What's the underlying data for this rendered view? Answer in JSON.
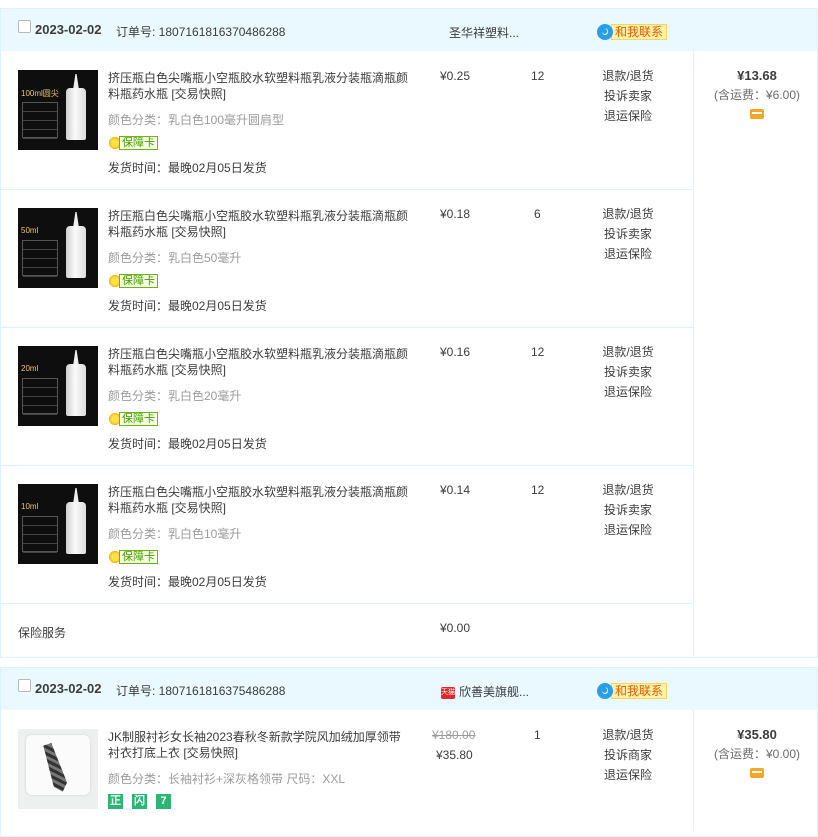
{
  "orders": [
    {
      "date": "2023-02-02",
      "order_no": "订单号: 1807161816370486288",
      "shop": "圣华祥塑料...",
      "contact": "和我联系",
      "items": [
        {
          "thumb_label": "100ml圆尖",
          "title": "挤压瓶白色尖嘴瓶小空瓶胶水软塑料瓶乳液分装瓶滴瓶颜料瓶药水瓶 [交易快照]",
          "spec": "颜色分类：乳白色100毫升圆肩型",
          "badge": "保障卡",
          "ship": "发货时间：最晚02月05日发货",
          "price": "¥0.25",
          "qty": "12",
          "ops": [
            "退款/退货",
            "投诉卖家",
            "退运保险"
          ]
        },
        {
          "thumb_label": "50ml",
          "title": "挤压瓶白色尖嘴瓶小空瓶胶水软塑料瓶乳液分装瓶滴瓶颜料瓶药水瓶 [交易快照]",
          "spec": "颜色分类：乳白色50毫升",
          "badge": "保障卡",
          "ship": "发货时间：最晚02月05日发货",
          "price": "¥0.18",
          "qty": "6",
          "ops": [
            "退款/退货",
            "投诉卖家",
            "退运保险"
          ]
        },
        {
          "thumb_label": "20ml",
          "title": "挤压瓶白色尖嘴瓶小空瓶胶水软塑料瓶乳液分装瓶滴瓶颜料瓶药水瓶 [交易快照]",
          "spec": "颜色分类：乳白色20毫升",
          "badge": "保障卡",
          "ship": "发货时间：最晚02月05日发货",
          "price": "¥0.16",
          "qty": "12",
          "ops": [
            "退款/退货",
            "投诉卖家",
            "退运保险"
          ]
        },
        {
          "thumb_label": "10ml",
          "title": "挤压瓶白色尖嘴瓶小空瓶胶水软塑料瓶乳液分装瓶滴瓶颜料瓶药水瓶 [交易快照]",
          "spec": "颜色分类：乳白色10毫升",
          "badge": "保障卡",
          "ship": "发货时间：最晚02月05日发货",
          "price": "¥0.14",
          "qty": "12",
          "ops": [
            "退款/退货",
            "投诉卖家",
            "退运保险"
          ]
        }
      ],
      "insurance_label": "保险服务",
      "insurance_price": "¥0.00",
      "total": "¥13.68",
      "total_ship": "(含运费：¥6.00)"
    },
    {
      "date": "2023-02-02",
      "order_no": "订单号: 1807161816375486288",
      "shop": "欣善美旗舰...",
      "shop_badge": "天猫",
      "contact": "和我联系",
      "items": [
        {
          "title": "JK制服衬衫女长袖2023春秋冬新款学院风加绒加厚领带衬衣打底上衣 [交易快照]",
          "spec": "颜色分类：长袖衬衫+深灰格领带  尺码：XXL",
          "old_price": "¥180.00",
          "price": "¥35.80",
          "qty": "1",
          "ops": [
            "退款/退货",
            "投诉商家",
            "退运保险"
          ],
          "mini_badges": [
            "正",
            "闪",
            "7"
          ]
        }
      ],
      "total": "¥35.80",
      "total_ship": "(含运费：¥0.00)"
    }
  ],
  "colors": {
    "header_bg": "#eaf8ff",
    "border": "#daf3ff",
    "contact_bg": "#fff2a8",
    "contact_text": "#e15b00",
    "badge_green": "#4a9a00",
    "mini_badge": "#2bb673"
  }
}
